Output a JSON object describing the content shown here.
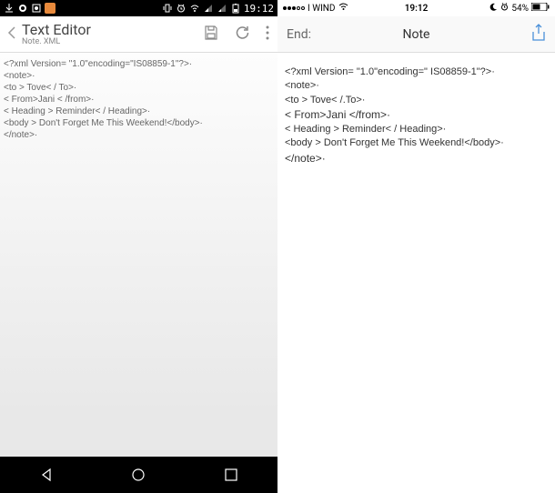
{
  "android": {
    "status": {
      "time": "19:12"
    },
    "appbar": {
      "title": "Text Editor",
      "subtitle": "Note. XML"
    },
    "content": {
      "l1": "<?xml Version= \"1.0\"encoding=\"IS08859-1\"?>·",
      "l2": "<note>·",
      "l3": "  <to > Tove< / To>·",
      "l4": "  < From>Jani < /from>·",
      "l5": "  < Heading > Reminder< / Heading>·",
      "l6": "  <body > Don't Forget Me This Weekend!</body>·",
      "l7": "</note>·"
    }
  },
  "ios": {
    "status": {
      "carrier": "I WIND",
      "time": "19:12",
      "battery": "54%"
    },
    "navbar": {
      "back": "End:",
      "title": "Note"
    },
    "content": {
      "l1": "<?xml Version= \"1.0\"encoding=\" IS08859-1\"?>·",
      "l2": "<note>·",
      "l3": " <to > Tove< /.To>·",
      "l4": " < From>Jani </from>·",
      "l5": " < Heading > Reminder< / Heading>·",
      "l6": " <body > Don't Forget Me This Weekend!</body>·",
      "l7": "</note>·"
    }
  }
}
